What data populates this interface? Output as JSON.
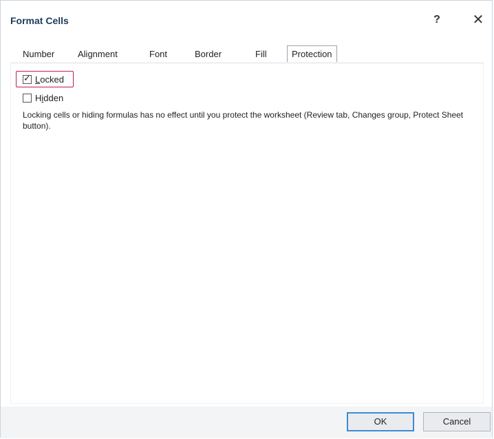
{
  "window": {
    "title": "Format Cells",
    "help_glyph": "?",
    "close_glyph": "✕"
  },
  "tabs": [
    {
      "label": "Number"
    },
    {
      "label": "Alignment"
    },
    {
      "label": "Font"
    },
    {
      "label": "Border"
    },
    {
      "label": "Fill"
    },
    {
      "label": "Protection",
      "active": true
    }
  ],
  "protection": {
    "locked": {
      "label": "Locked",
      "access_key": "L",
      "checked": true
    },
    "hidden": {
      "label": "Hidden",
      "access_key": "i",
      "checked": false
    },
    "note": "Locking cells or hiding formulas has no effect until you protect the worksheet (Review tab, Changes group, Protect Sheet button)."
  },
  "buttons": {
    "ok": "OK",
    "cancel": "Cancel"
  },
  "colors": {
    "highlight": "#c2185b",
    "title_text": "#1f3a5c",
    "default_button_border": "#3c8ad6"
  }
}
